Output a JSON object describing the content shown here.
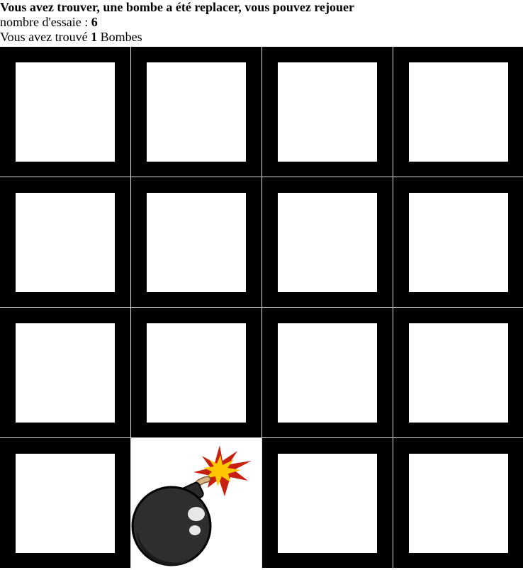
{
  "status": {
    "message": "Vous avez trouver, une bombe a été replacer, vous pouvez rejouer",
    "attempts_label": "nombre d'essaie : ",
    "attempts_value": "6",
    "found_prefix": "Vous avez trouvé ",
    "found_value": "1",
    "found_suffix": " Bombes"
  },
  "grid": {
    "rows": 4,
    "cols": 4,
    "cells": [
      "hidden",
      "hidden",
      "hidden",
      "hidden",
      "hidden",
      "hidden",
      "hidden",
      "hidden",
      "hidden",
      "hidden",
      "hidden",
      "hidden",
      "hidden",
      "bomb",
      "hidden",
      "hidden"
    ]
  }
}
